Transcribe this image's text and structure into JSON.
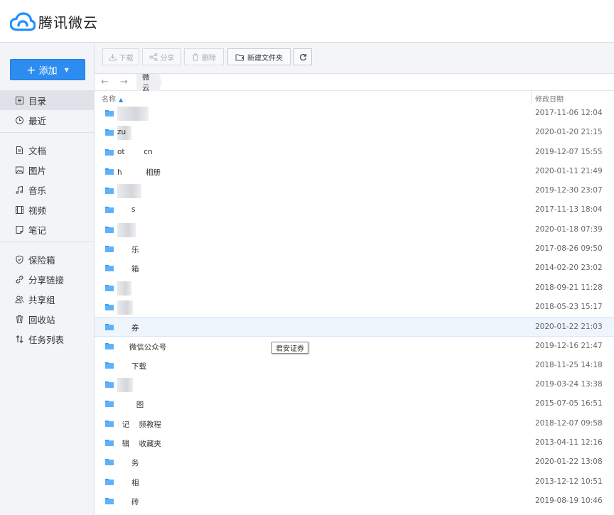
{
  "app": {
    "title": "腾讯微云"
  },
  "sidebar": {
    "add_label": "添加",
    "groups": [
      [
        {
          "label": "目录",
          "icon": "list-icon",
          "active": true
        },
        {
          "label": "最近",
          "icon": "clock-icon"
        }
      ],
      [
        {
          "label": "文档",
          "icon": "document-icon"
        },
        {
          "label": "图片",
          "icon": "image-icon"
        },
        {
          "label": "音乐",
          "icon": "music-icon"
        },
        {
          "label": "视频",
          "icon": "video-icon"
        },
        {
          "label": "笔记",
          "icon": "note-icon"
        }
      ],
      [
        {
          "label": "保险箱",
          "icon": "shield-icon"
        },
        {
          "label": "分享链接",
          "icon": "link-icon"
        },
        {
          "label": "共享组",
          "icon": "group-icon"
        },
        {
          "label": "回收站",
          "icon": "trash-icon"
        },
        {
          "label": "任务列表",
          "icon": "transfer-icon"
        }
      ]
    ]
  },
  "toolbar": {
    "download": "下载",
    "share": "分享",
    "delete": "删除",
    "new_folder": "新建文件夹",
    "refresh": "refresh-icon"
  },
  "breadcrumb": {
    "current": "微云"
  },
  "list": {
    "col_name": "名称",
    "col_date": "修改日期",
    "rows": [
      {
        "name": "",
        "date": "2017-11-06 12:04",
        "blur": 44
      },
      {
        "name": "zu",
        "date": "2020-01-20 21:15",
        "blur": 20
      },
      {
        "name": "ot        cn",
        "date": "2019-12-07 15:55",
        "blur": 0
      },
      {
        "name": "h          相册",
        "date": "2020-01-11 21:49",
        "blur": 0
      },
      {
        "name": "",
        "date": "2019-12-30 23:07",
        "blur": 34
      },
      {
        "name": "      s",
        "date": "2017-11-13 18:04",
        "blur": 0
      },
      {
        "name": "",
        "date": "2020-01-18 07:39",
        "blur": 26
      },
      {
        "name": "      乐",
        "date": "2017-08-26 09:50",
        "blur": 0
      },
      {
        "name": "      箱",
        "date": "2014-02-20 23:02",
        "blur": 0
      },
      {
        "name": "",
        "date": "2018-09-21 11:28",
        "blur": 20
      },
      {
        "name": "",
        "date": "2018-05-23 15:17",
        "blur": 22
      },
      {
        "name": "      券",
        "date": "2020-01-22 21:03",
        "blur": 0,
        "hover": true
      },
      {
        "name": "     微信公众号",
        "date": "2019-12-16 21:47",
        "blur": 0
      },
      {
        "name": "      下载",
        "date": "2018-11-25 14:18",
        "blur": 0
      },
      {
        "name": "",
        "date": "2019-03-24 13:38",
        "blur": 22
      },
      {
        "name": "        图",
        "date": "2015-07-05 16:51",
        "blur": 0
      },
      {
        "name": "  记    频教程",
        "date": "2018-12-07 09:58",
        "blur": 0
      },
      {
        "name": "  辑    收藏夹",
        "date": "2013-04-11 12:16",
        "blur": 0
      },
      {
        "name": "      务",
        "date": "2020-01-22 13:08",
        "blur": 0
      },
      {
        "name": "      相",
        "date": "2013-12-12 10:51",
        "blur": 0
      },
      {
        "name": "      砖",
        "date": "2019-08-19 10:46",
        "blur": 0
      }
    ]
  },
  "tooltip": {
    "text": "君安证券"
  },
  "colors": {
    "accent": "#2d8cf0",
    "folder": "#3d9ff5",
    "row_hover": "#eef5fd"
  }
}
